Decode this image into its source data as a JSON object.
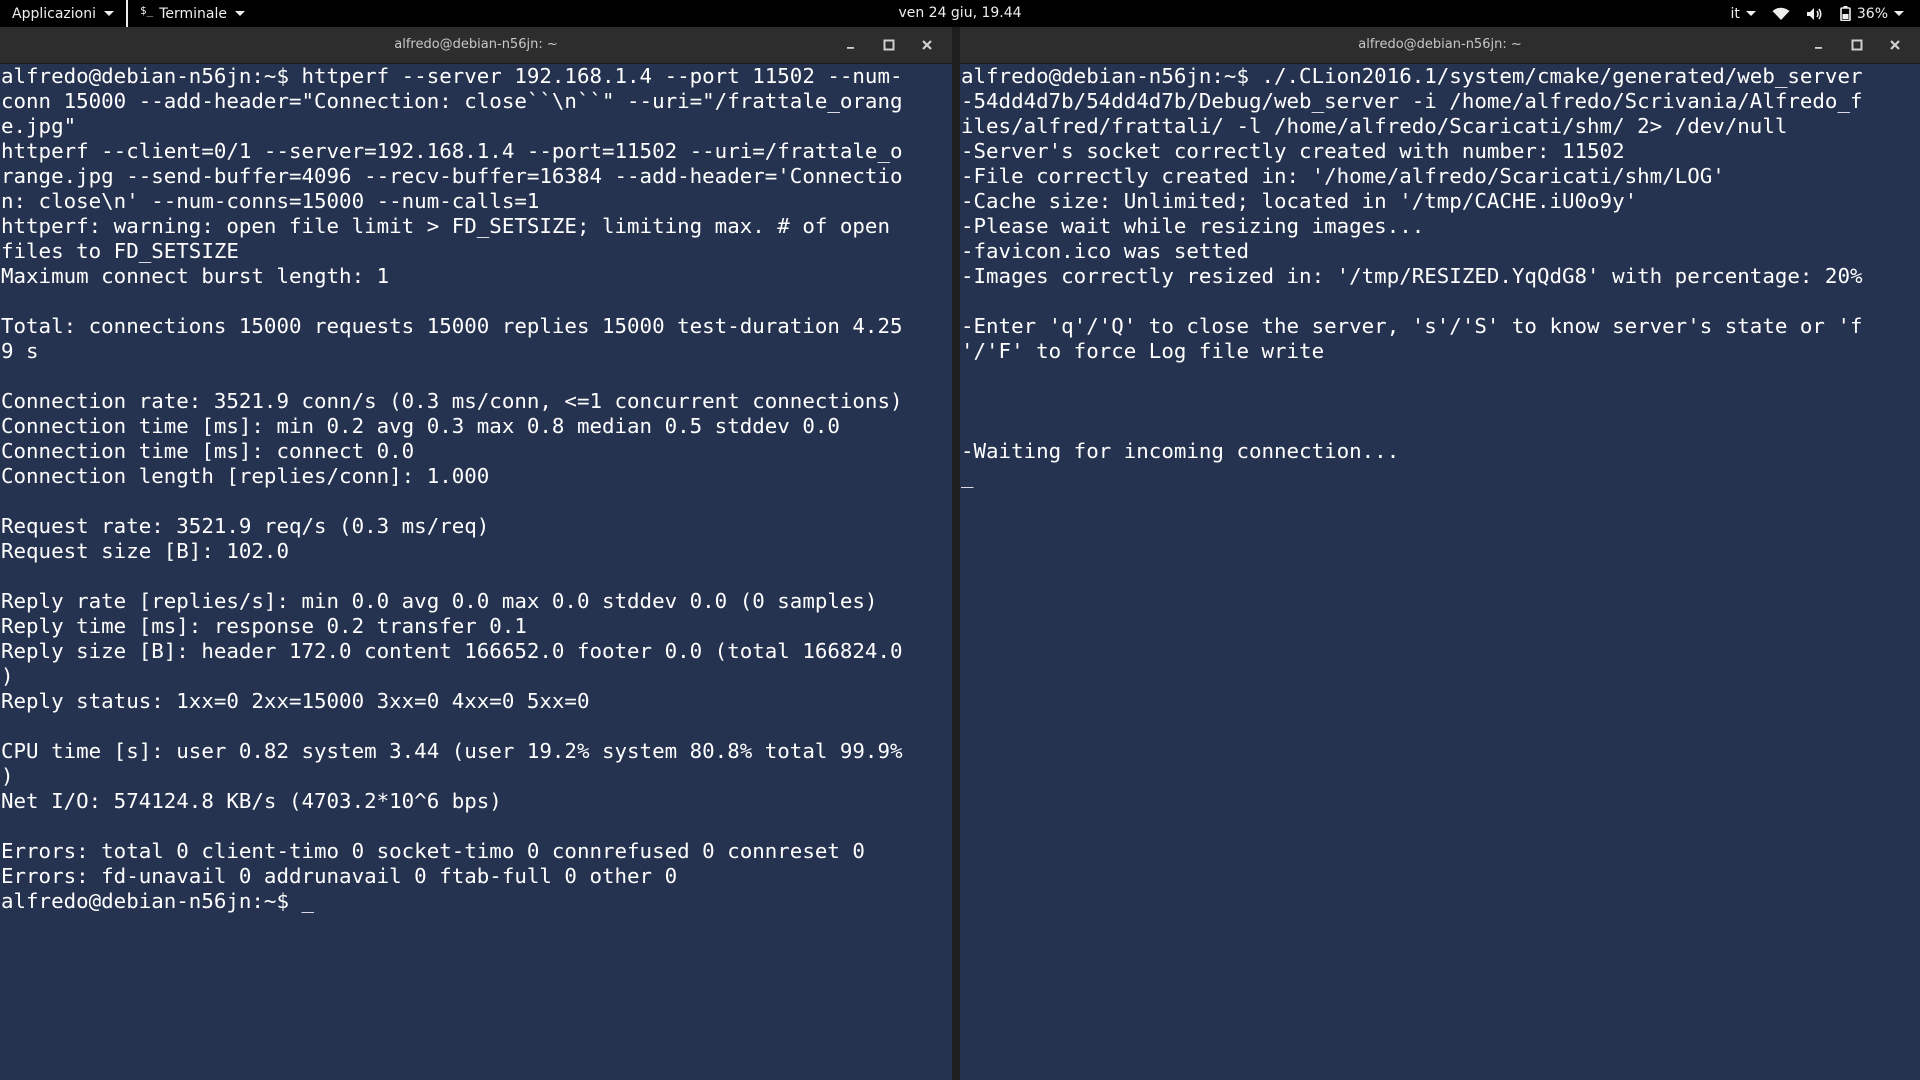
{
  "topbar": {
    "apps_label": "Applicazioni",
    "app_glyph": "$_",
    "app_label": "Terminale",
    "clock": "ven 24 giu, 19.44",
    "language": "it",
    "battery_percent": "36%",
    "icons": [
      "wifi-icon",
      "volume-icon",
      "battery-icon",
      "chevron-down-icon"
    ]
  },
  "left_window": {
    "title": "alfredo@debian-n56jn: ~",
    "lines": [
      "alfredo@debian-n56jn:~$ httperf --server 192.168.1.4 --port 11502 --num-",
      "conn 15000 --add-header=\"Connection: close``\\n``\" --uri=\"/frattale_orang",
      "e.jpg\"",
      "httperf --client=0/1 --server=192.168.1.4 --port=11502 --uri=/frattale_o",
      "range.jpg --send-buffer=4096 --recv-buffer=16384 --add-header='Connectio",
      "n: close\\n' --num-conns=15000 --num-calls=1",
      "httperf: warning: open file limit > FD_SETSIZE; limiting max. # of open",
      "files to FD_SETSIZE",
      "Maximum connect burst length: 1",
      "",
      "Total: connections 15000 requests 15000 replies 15000 test-duration 4.25",
      "9 s",
      "",
      "Connection rate: 3521.9 conn/s (0.3 ms/conn, <=1 concurrent connections)",
      "Connection time [ms]: min 0.2 avg 0.3 max 0.8 median 0.5 stddev 0.0",
      "Connection time [ms]: connect 0.0",
      "Connection length [replies/conn]: 1.000",
      "",
      "Request rate: 3521.9 req/s (0.3 ms/req)",
      "Request size [B]: 102.0",
      "",
      "Reply rate [replies/s]: min 0.0 avg 0.0 max 0.0 stddev 0.0 (0 samples)",
      "Reply time [ms]: response 0.2 transfer 0.1",
      "Reply size [B]: header 172.0 content 166652.0 footer 0.0 (total 166824.0",
      ")",
      "Reply status: 1xx=0 2xx=15000 3xx=0 4xx=0 5xx=0",
      "",
      "CPU time [s]: user 0.82 system 3.44 (user 19.2% system 80.8% total 99.9%",
      ")",
      "Net I/O: 574124.8 KB/s (4703.2*10^6 bps)",
      "",
      "Errors: total 0 client-timo 0 socket-timo 0 connrefused 0 connreset 0",
      "Errors: fd-unavail 0 addrunavail 0 ftab-full 0 other 0",
      "alfredo@debian-n56jn:~$ _"
    ]
  },
  "right_window": {
    "title": "alfredo@debian-n56jn: ~",
    "lines": [
      "alfredo@debian-n56jn:~$ ./.CLion2016.1/system/cmake/generated/web_server",
      "-54dd4d7b/54dd4d7b/Debug/web_server -i /home/alfredo/Scrivania/Alfredo_f",
      "iles/alfred/frattali/ -l /home/alfredo/Scaricati/shm/ 2> /dev/null",
      "-Server's socket correctly created with number: 11502",
      "-File correctly created in: '/home/alfredo/Scaricati/shm/LOG'",
      "-Cache size: Unlimited; located in '/tmp/CACHE.iU0o9y'",
      "-Please wait while resizing images...",
      "-favicon.ico was setted",
      "-Images correctly resized in: '/tmp/RESIZED.YqQdG8' with percentage: 20%",
      "",
      "-Enter 'q'/'Q' to close the server, 's'/'S' to know server's state or 'f",
      "'/'F' to force Log file write",
      "",
      "",
      "",
      "-Waiting for incoming connection...",
      "_"
    ]
  },
  "colors": {
    "terminal_bg": "#253350",
    "terminal_fg": "#ffffff",
    "titlebar_bg": "#2d2d2d",
    "topbar_bg": "#000000"
  }
}
